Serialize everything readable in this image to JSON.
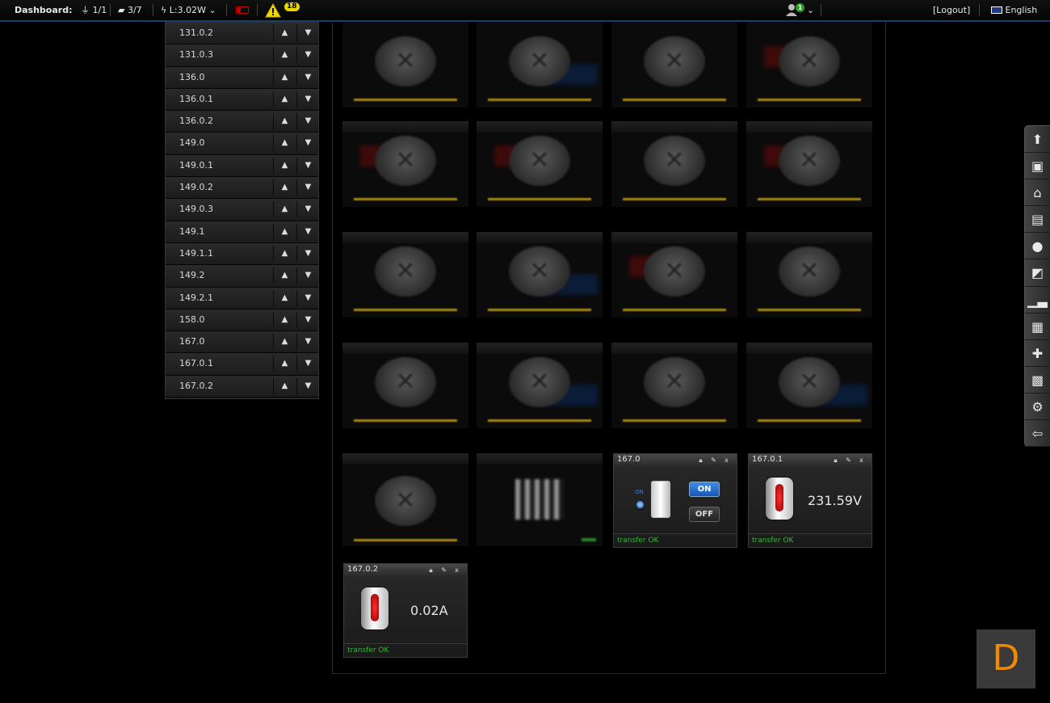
{
  "topbar": {
    "dashboard_label": "Dashboard:",
    "plug_count": "1/1",
    "scene_count": "3/7",
    "power": "L:3.02W",
    "warning_count": "18",
    "user_badge": "1",
    "logout": "[Logout]",
    "language": "English"
  },
  "sortlist": {
    "items": [
      "131.0.2",
      "131.0.3",
      "136.0",
      "136.0.1",
      "136.0.2",
      "149.0",
      "149.0.1",
      "149.0.2",
      "149.0.3",
      "149.1",
      "149.1.1",
      "149.2",
      "149.2.1",
      "158.0",
      "167.0",
      "167.0.1",
      "167.0.2"
    ]
  },
  "widgets": {
    "switch": {
      "title": "167.0",
      "on_indicator": "ON",
      "on_label": "ON",
      "off_label": "OFF",
      "status": "transfer OK"
    },
    "voltage": {
      "title": "167.0.1",
      "value": "231.59V",
      "status": "transfer OK"
    },
    "current": {
      "title": "167.0.2",
      "value": "0.02A",
      "status": "transfer OK"
    }
  },
  "sidetoolbar": {
    "icons": [
      "upload-icon",
      "save-icon",
      "home-icon",
      "devices-icon",
      "location-icon",
      "scene-icon",
      "chart-icon",
      "archive-icon",
      "plugin-icon",
      "schedule-icon",
      "settings-icon",
      "exit-icon"
    ]
  },
  "corner_logo": "D"
}
